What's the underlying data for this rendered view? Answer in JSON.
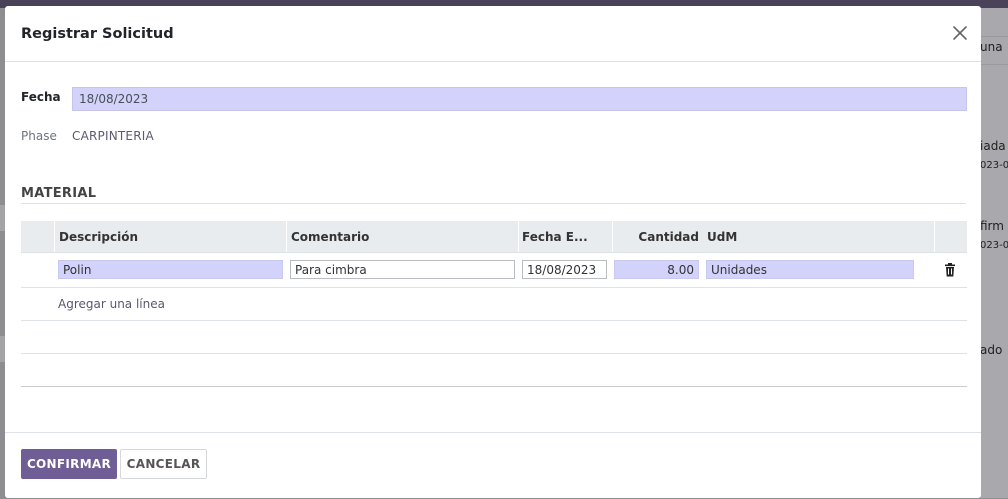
{
  "dialog": {
    "title": "Registrar Solicitud",
    "close_icon": "close-icon"
  },
  "form": {
    "fecha_label": "Fecha",
    "fecha_value": "18/08/2023",
    "phase_label": "Phase",
    "phase_value": "CARPINTERIA"
  },
  "material": {
    "section_title": "MATERIAL",
    "columns": [
      "Descripción",
      "Comentario",
      "Fecha E...",
      "Cantidad",
      "UdM"
    ],
    "rows": [
      {
        "descripcion": "Polin",
        "comentario": "Para cimbra",
        "fecha": "18/08/2023",
        "cantidad": "8.00",
        "udm": "Unidades"
      }
    ],
    "add_line": "Agregar una línea",
    "delete_icon": "trash-icon"
  },
  "footer": {
    "confirm": "CONFIRMAR",
    "cancel": "CANCELAR"
  },
  "background": {
    "peek_texts": [
      "una",
      "iada",
      "023-0",
      "firm",
      "023-0",
      "ado"
    ]
  },
  "colors": {
    "primary": "#6f5e95",
    "required_field": "#d3d2fb",
    "top_bar": "#4a4259"
  }
}
